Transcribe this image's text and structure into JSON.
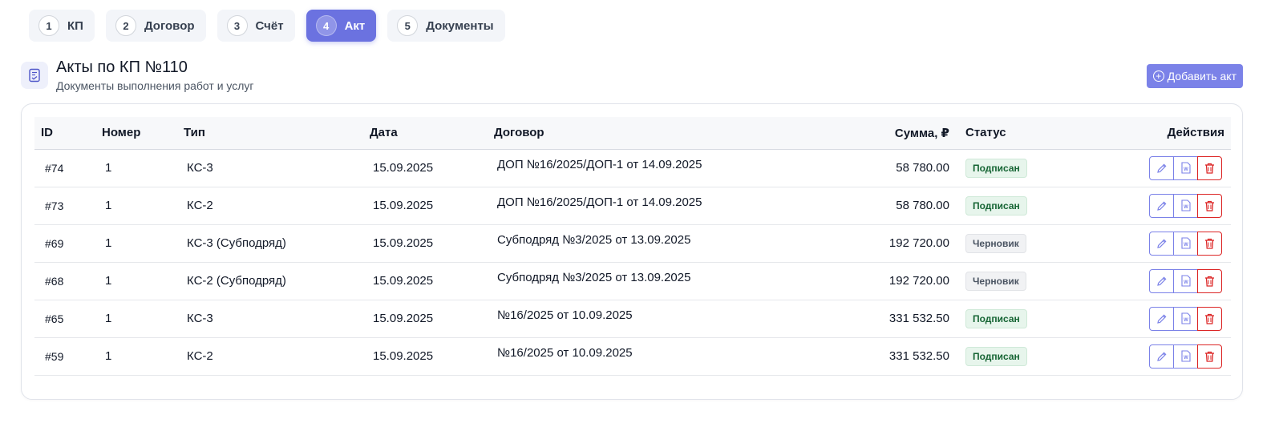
{
  "steps": [
    {
      "num": "1",
      "label": "КП"
    },
    {
      "num": "2",
      "label": "Договор"
    },
    {
      "num": "3",
      "label": "Счёт"
    },
    {
      "num": "4",
      "label": "Акт"
    },
    {
      "num": "5",
      "label": "Документы"
    }
  ],
  "active_step": "4",
  "header": {
    "icon": "document-check-icon",
    "title": "Акты по КП №110",
    "subtitle": "Документы выполнения работ и услуг",
    "add_button_label": "Добавить акт"
  },
  "table": {
    "columns": {
      "id": "ID",
      "number": "Номер",
      "type": "Тип",
      "date": "Дата",
      "contract": "Договор",
      "sum": "Сумма, ₽",
      "status": "Статус",
      "actions": "Действия"
    },
    "rows": [
      {
        "id": "#74",
        "number": "1",
        "type": "КС-3",
        "date": "15.09.2025",
        "contract": "ДОП №16/2025/ДОП-1 от 14.09.2025",
        "sum": "58 780.00",
        "status": "Подписан",
        "status_kind": "signed"
      },
      {
        "id": "#73",
        "number": "1",
        "type": "КС-2",
        "date": "15.09.2025",
        "contract": "ДОП №16/2025/ДОП-1 от 14.09.2025",
        "sum": "58 780.00",
        "status": "Подписан",
        "status_kind": "signed"
      },
      {
        "id": "#69",
        "number": "1",
        "type": "КС-3 (Субподряд)",
        "date": "15.09.2025",
        "contract": "Субподряд №3/2025 от 13.09.2025",
        "sum": "192 720.00",
        "status": "Черновик",
        "status_kind": "draft"
      },
      {
        "id": "#68",
        "number": "1",
        "type": "КС-2 (Субподряд)",
        "date": "15.09.2025",
        "contract": "Субподряд №3/2025 от 13.09.2025",
        "sum": "192 720.00",
        "status": "Черновик",
        "status_kind": "draft"
      },
      {
        "id": "#65",
        "number": "1",
        "type": "КС-3",
        "date": "15.09.2025",
        "contract": "№16/2025 от 10.09.2025",
        "sum": "331 532.50",
        "status": "Подписан",
        "status_kind": "signed"
      },
      {
        "id": "#59",
        "number": "1",
        "type": "КС-2",
        "date": "15.09.2025",
        "contract": "№16/2025 от 10.09.2025",
        "sum": "331 532.50",
        "status": "Подписан",
        "status_kind": "signed"
      }
    ],
    "row_actions": [
      {
        "name": "edit-button",
        "icon": "pencil-icon"
      },
      {
        "name": "word-export-button",
        "icon": "word-doc-icon"
      },
      {
        "name": "delete-button",
        "icon": "trash-icon"
      }
    ]
  },
  "colors": {
    "accent": "#6b72e0",
    "button": "#7b82e8",
    "danger": "#dc2626",
    "signed_text": "#166534",
    "signed_bg": "#e7f5ec",
    "draft_text": "#4b5563",
    "draft_bg": "#f1f2f4"
  }
}
